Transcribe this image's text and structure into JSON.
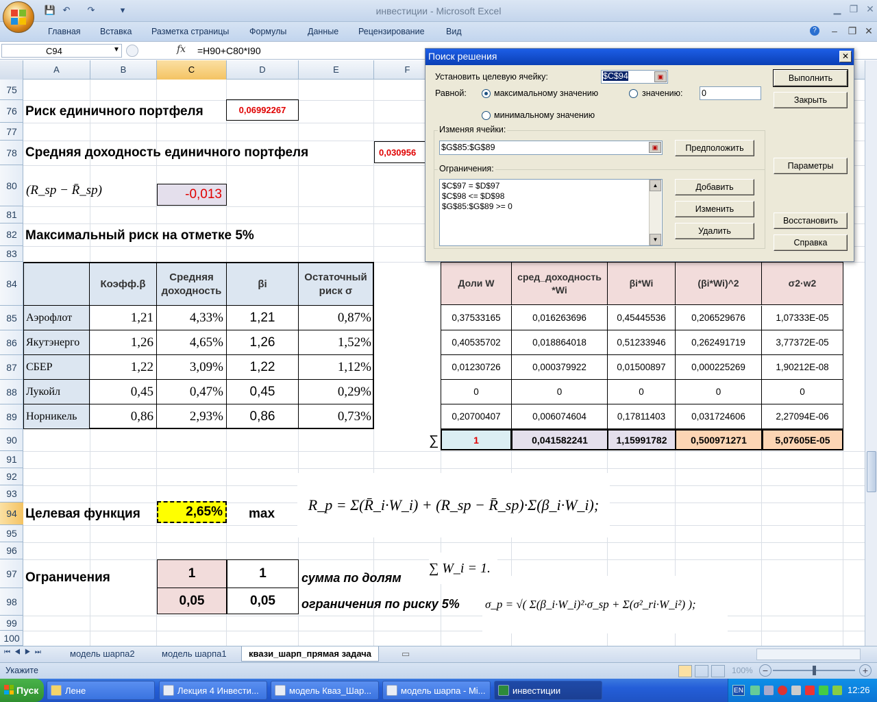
{
  "window": {
    "title": "инвестиции - Microsoft Excel"
  },
  "ribbon": {
    "tabs": [
      "Главная",
      "Вставка",
      "Разметка страницы",
      "Формулы",
      "Данные",
      "Рецензирование",
      "Вид"
    ]
  },
  "formula_bar": {
    "name_box": "C94",
    "fx": "fx",
    "formula": "=H90+C80*I90"
  },
  "columns": [
    "A",
    "B",
    "C",
    "D",
    "E",
    "F"
  ],
  "rows": [
    "75",
    "76",
    "77",
    "78",
    "80",
    "81",
    "82",
    "83",
    "84",
    "85",
    "86",
    "87",
    "88",
    "89",
    "90",
    "91",
    "92",
    "93",
    "94",
    "95",
    "96",
    "97",
    "98",
    "99",
    "100"
  ],
  "sheet": {
    "r76_label": "Риск единичного портфеля",
    "r76_value": "0,06992267",
    "r78_label": "Средняя доходность единичного портфеля",
    "r78_value": "0,030956",
    "r80_formula": "(R_sp − R̄_sp)",
    "r80_value": "-0,013",
    "r82_label": "Максимальный риск на отметке 5%",
    "left_table": {
      "headers": [
        "Коэфф.β",
        "Средняя доходность",
        "βi",
        "Остаточный риск σ"
      ],
      "rows": [
        {
          "name": "Аэрофлот",
          "beta": "1,21",
          "ret": "4,33%",
          "bi": "1,21",
          "sigma": "0,87%"
        },
        {
          "name": "Якутэнерго",
          "beta": "1,26",
          "ret": "4,65%",
          "bi": "1,26",
          "sigma": "1,52%"
        },
        {
          "name": "СБЕР",
          "beta": "1,22",
          "ret": "3,09%",
          "bi": "1,22",
          "sigma": "1,12%"
        },
        {
          "name": "Лукойл",
          "beta": "0,45",
          "ret": "0,47%",
          "bi": "0,45",
          "sigma": "0,29%"
        },
        {
          "name": "Норникель",
          "beta": "0,86",
          "ret": "2,93%",
          "bi": "0,86",
          "sigma": "0,73%"
        }
      ]
    },
    "right_table": {
      "headers": [
        "Доли W",
        "сред_доходность *Wi",
        "βi*Wi",
        "(βi*Wi)^2",
        "σ2·w2"
      ],
      "rows": [
        [
          "0,37533165",
          "0,016263696",
          "0,45445536",
          "0,206529676",
          "1,07333E-05"
        ],
        [
          "0,40535702",
          "0,018864018",
          "0,51233946",
          "0,262491719",
          "3,77372E-05"
        ],
        [
          "0,01230726",
          "0,000379922",
          "0,01500897",
          "0,000225269",
          "1,90212E-08"
        ],
        [
          "0",
          "0",
          "0",
          "0",
          "0"
        ],
        [
          "0,20700407",
          "0,006074604",
          "0,17811403",
          "0,031724606",
          "2,27094E-06"
        ]
      ],
      "sum_symbol": "∑",
      "totals": [
        "1",
        "0,041582241",
        "1,15991782",
        "0,500971271",
        "5,07605E-05"
      ]
    },
    "r94_label": "Целевая функция",
    "r94_value": "2,65%",
    "r94_max": "max",
    "formula_rp": "R_p = Σ(R̄_i·W_i) + (R_sp − R̄_sp)·Σ(β_i·W_i);",
    "r97_label": "Ограничения",
    "r97_c": "1",
    "r97_d": "1",
    "r97_note": "сумма по долям",
    "formula_sum": "∑ W_i = 1.",
    "r98_c": "0,05",
    "r98_d": "0,05",
    "r98_note": "ограничения по риску 5%",
    "formula_sigma": "σ_p = √( Σ(β_i·W_i)²·σ_sp + Σ(σ²_ri·W_i²) );"
  },
  "solver": {
    "title": "Поиск решения",
    "target_label": "Установить целевую ячейку:",
    "target_value": "$C$94",
    "equal_label": "Равной:",
    "opt_max": "максимальному значению",
    "opt_value": "значению:",
    "value_field": "0",
    "opt_min": "минимальному значению",
    "changing_label": "Изменяя ячейки:",
    "changing_value": "$G$85:$G$89",
    "constraints_label": "Ограничения:",
    "constraints": [
      "$C$97 = $D$97",
      "$C$98 <= $D$98",
      "$G$85:$G$89 >= 0"
    ],
    "buttons": {
      "run": "Выполнить",
      "close": "Закрыть",
      "guess": "Предположить",
      "params": "Параметры",
      "add": "Добавить",
      "change": "Изменить",
      "delete": "Удалить",
      "reset": "Восстановить",
      "help": "Справка"
    }
  },
  "sheet_tabs": [
    "модель шарпа2",
    "модель шарпа1",
    "квази_шарп_прямая задача"
  ],
  "status": {
    "mode": "Укажите",
    "zoom": "100%"
  },
  "taskbar": {
    "start": "Пуск",
    "items": [
      "Лене",
      "Лекция 4 Инвести...",
      "модель Кваз_Шар...",
      "модель шарпа - Mi...",
      "инвестиции"
    ],
    "lang": "EN",
    "time": "12:26"
  }
}
